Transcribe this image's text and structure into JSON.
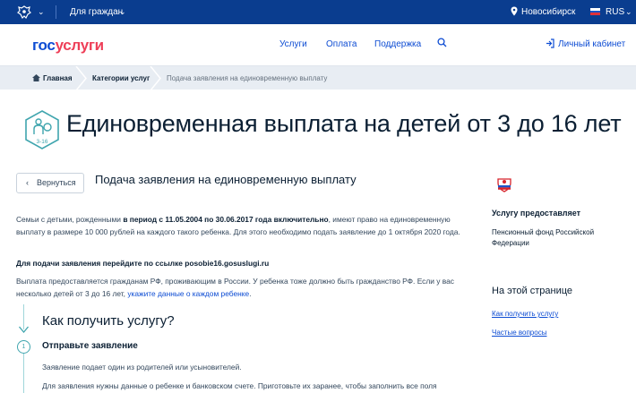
{
  "topbar": {
    "citizens_label": "Для граждан",
    "city": "Новосибирск",
    "lang": "RUS",
    "colors": {
      "background": "#0a3d8f"
    }
  },
  "header": {
    "logo_part1": "гос",
    "logo_part2": "услуги",
    "nav": [
      "Услуги",
      "Оплата",
      "Поддержка"
    ],
    "cabinet": "Личный кабинет",
    "colors": {
      "accent": "#0d4cd3",
      "brand_red": "#ee3f58"
    }
  },
  "breadcrumb": {
    "home": "Главная",
    "category": "Категории услуг",
    "current": "Подача заявления на единовременную выплату"
  },
  "page": {
    "icon_text": "3-16",
    "title": "Единовременная выплата на детей от 3 до 16 лет",
    "back_label": "Вернуться",
    "section_title": "Подача заявления на единовременную выплату",
    "p1_a": "Семьи с детьми, рожденными ",
    "p1_b": "в период с 11.05.2004 по 30.06.2017 года включительно",
    "p1_c": ", имеют право на единовременную выплату в размере 10 000 рублей на каждого такого ребенка. Для этого необходимо подать заявление до 1 октября 2020 года.",
    "p2_a": "Для подачи заявления перейдите по ссылке ",
    "p2_link": "posobie16.gosuslugi.ru",
    "p3_a": "Выплата предоставляется гражданам РФ, проживающим в России. У ребенка тоже должно быть гражданство РФ. Если у вас несколько детей от 3 до 16 лет, ",
    "p3_link": "укажите данные о каждом ребенке",
    "p3_end": ".",
    "how_title": "Как получить услугу?",
    "step_num": "1",
    "step_title": "Отправьте заявление",
    "step_p1": "Заявление подает один из родителей или усыновителей.",
    "step_p2": "Для заявления нужны данные о ребенке и банковском счете. Приготовьте их заранее, чтобы заполнить все поля"
  },
  "sidebar": {
    "provider_heading": "Услугу предоставляет",
    "provider_name": "Пенсионный фонд Российской Федерации",
    "on_page_heading": "На этой странице",
    "links": [
      "Как получить услугу",
      "Частые вопросы"
    ]
  }
}
